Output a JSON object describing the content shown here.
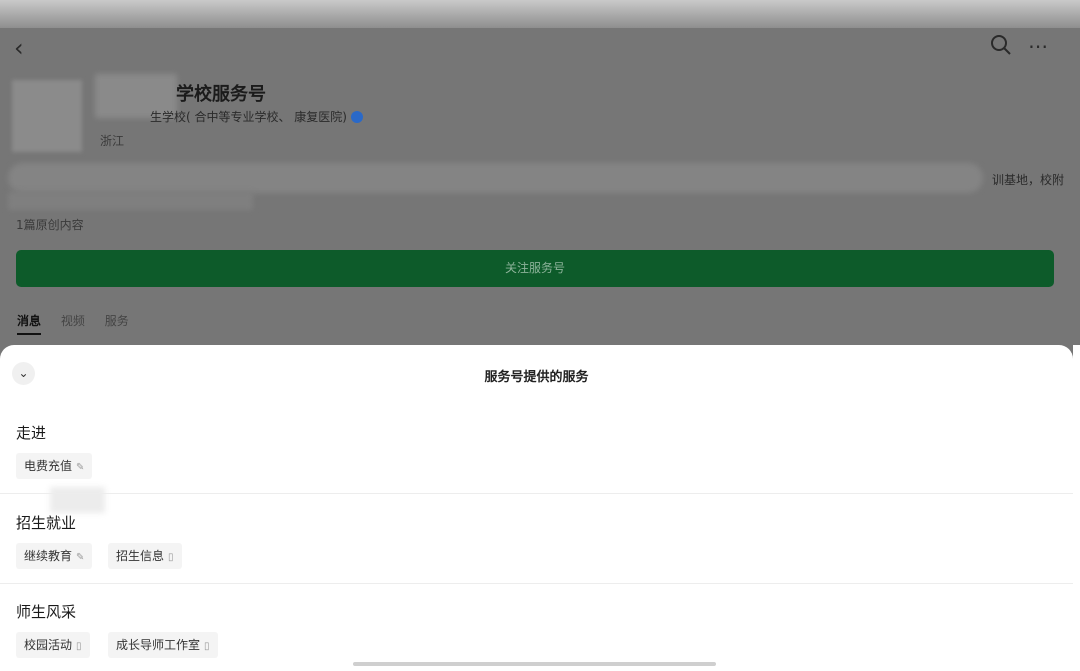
{
  "header": {
    "back_icon": "chevron-left-icon",
    "search_icon": "search-icon",
    "more_icon": "more-icon"
  },
  "profile": {
    "account_name": "学校服务号",
    "subtitle": "生学校(   合中等专业学校、    康复医院)",
    "region": "浙江",
    "desc_tail": "训基地，校附",
    "original_content": "1篇原创内容",
    "follow_label": "关注服务号"
  },
  "tabs": [
    {
      "label": "消息",
      "active": true
    },
    {
      "label": "视频",
      "active": false
    },
    {
      "label": "服务",
      "active": false
    }
  ],
  "sheet": {
    "title": "服务号提供的服务",
    "sections": [
      {
        "title": "走进",
        "items": [
          {
            "label": "电费充值",
            "icon": "edit-icon"
          }
        ]
      },
      {
        "title": "招生就业",
        "items": [
          {
            "label": "继续教育",
            "icon": "edit-icon"
          },
          {
            "label": "招生信息",
            "icon": "doc-icon"
          }
        ]
      },
      {
        "title": "师生风采",
        "items": [
          {
            "label": "校园活动",
            "icon": "doc-icon"
          },
          {
            "label": "成长导师工作室",
            "icon": "doc-icon"
          }
        ]
      }
    ]
  },
  "colors": {
    "follow_bg": "#0d5b2a",
    "verified": "#2a69c8"
  }
}
